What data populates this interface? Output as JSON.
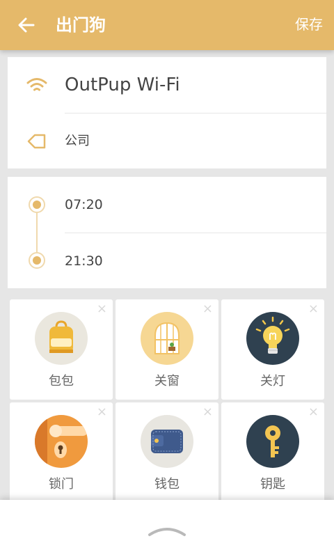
{
  "header": {
    "title": "出门狗",
    "save_label": "保存",
    "background_color": "#e5b96a"
  },
  "wifi_card": {
    "wifi_name": "OutPup Wi-Fi",
    "wifi_icon": "wifi-icon",
    "place": "公司",
    "place_icon": "tag-icon"
  },
  "time_card": {
    "start_time": "07:20",
    "end_time": "21:30"
  },
  "items": [
    {
      "label": "包包",
      "icon": "backpack-icon"
    },
    {
      "label": "关窗",
      "icon": "window-icon"
    },
    {
      "label": "关灯",
      "icon": "light-bulb-icon"
    },
    {
      "label": "锁门",
      "icon": "door-lock-icon"
    },
    {
      "label": "钱包",
      "icon": "wallet-icon"
    },
    {
      "label": "钥匙",
      "icon": "key-icon"
    }
  ],
  "remove_glyph": "×",
  "accent_color": "#e5b96a"
}
